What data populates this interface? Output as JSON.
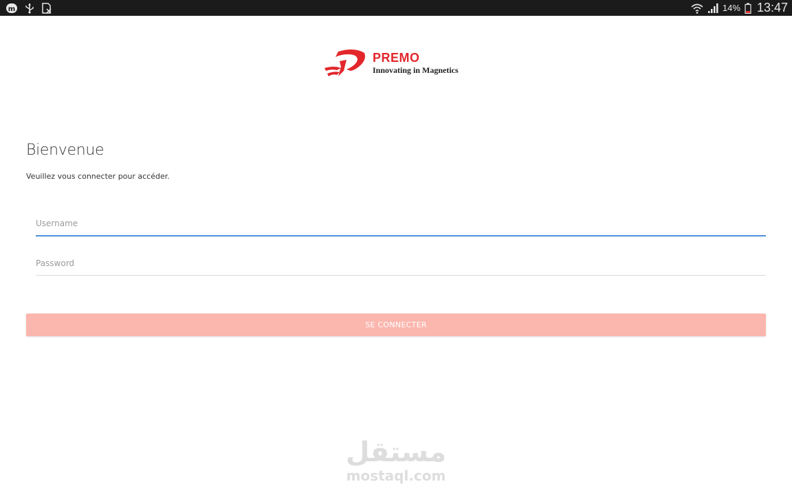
{
  "status_bar": {
    "left_icons": [
      "app-icon",
      "usb-icon",
      "no-sim-icon"
    ],
    "right_icons": [
      "wifi-icon",
      "signal-icon",
      "battery-icon"
    ],
    "battery": "14%",
    "time": "13:47"
  },
  "logo": {
    "brand": "PREMO",
    "tagline": "Innovating in Magnetics",
    "color": "#e3262b"
  },
  "welcome": {
    "title": "Bienvenue",
    "subtitle": "Veuillez vous connecter pour accéder."
  },
  "form": {
    "username": {
      "value": "",
      "placeholder": "Username"
    },
    "password": {
      "value": "",
      "placeholder": "Password"
    },
    "submit_label": "SE CONNECTER",
    "accent": "#4a90d9",
    "button_color": "#fbb6ae"
  },
  "watermark": {
    "arabic": "مستقل",
    "latin": "mostaql.com"
  }
}
